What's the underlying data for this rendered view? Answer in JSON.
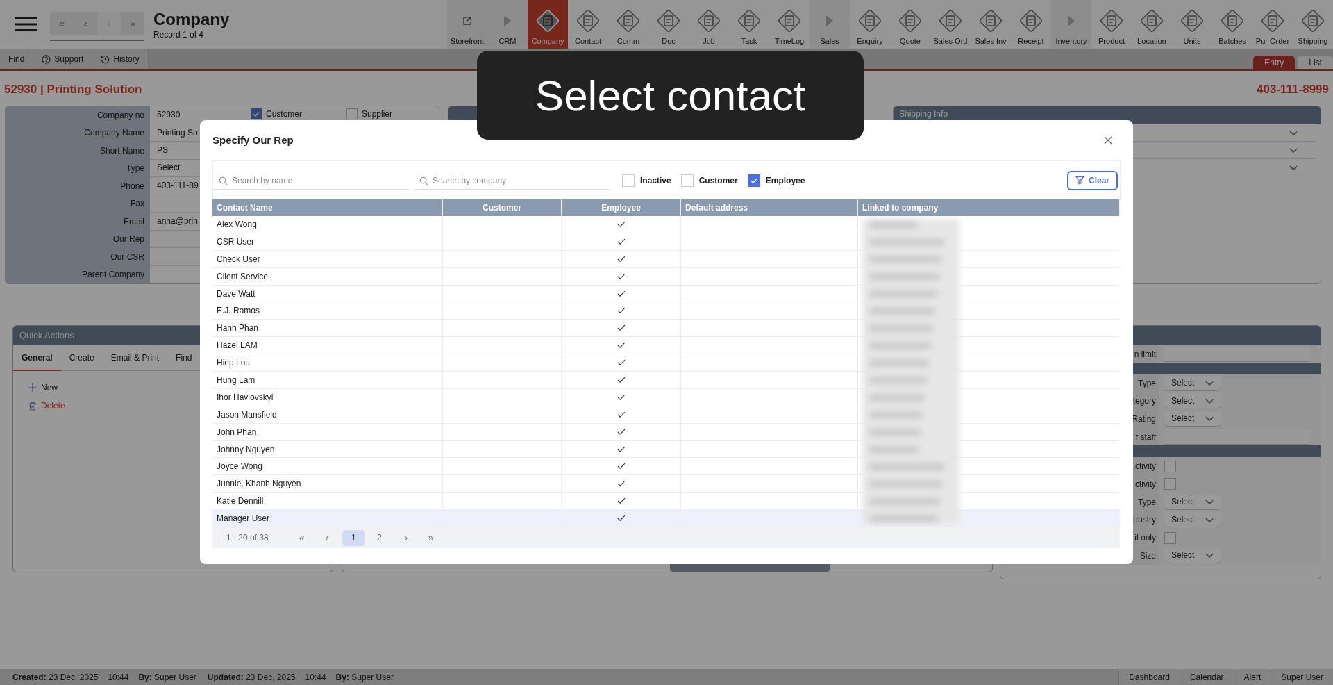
{
  "header": {
    "nav_buttons": [
      {
        "label": "«",
        "disabled": false
      },
      {
        "label": "‹",
        "disabled": false
      },
      {
        "label": "›",
        "disabled": true
      },
      {
        "label": "»",
        "disabled": false
      }
    ],
    "title": "Company",
    "record": "Record 1 of 4"
  },
  "modules": [
    {
      "label": "Storefront",
      "kind": "link",
      "selected": false
    },
    {
      "label": "CRM",
      "kind": "section",
      "selected": false
    },
    {
      "label": "Company",
      "kind": "module",
      "selected": true
    },
    {
      "label": "Contact",
      "kind": "module",
      "selected": false
    },
    {
      "label": "Comm",
      "kind": "module",
      "selected": false
    },
    {
      "label": "Doc",
      "kind": "module",
      "selected": false
    },
    {
      "label": "Job",
      "kind": "module",
      "selected": false
    },
    {
      "label": "Task",
      "kind": "module",
      "selected": false
    },
    {
      "label": "TimeLog",
      "kind": "module",
      "selected": false
    },
    {
      "label": "Sales",
      "kind": "section",
      "selected": false
    },
    {
      "label": "Enquiry",
      "kind": "module",
      "selected": false
    },
    {
      "label": "Quote",
      "kind": "module",
      "selected": false
    },
    {
      "label": "Sales Ord",
      "kind": "module",
      "selected": false
    },
    {
      "label": "Sales Inv",
      "kind": "module",
      "selected": false
    },
    {
      "label": "Receipt",
      "kind": "module",
      "selected": false
    },
    {
      "label": "Inventory",
      "kind": "section",
      "selected": false
    },
    {
      "label": "Product",
      "kind": "module",
      "selected": false
    },
    {
      "label": "Location",
      "kind": "module",
      "selected": false
    },
    {
      "label": "Units",
      "kind": "module",
      "selected": false
    },
    {
      "label": "Batches",
      "kind": "module",
      "selected": false
    },
    {
      "label": "Pur Order",
      "kind": "module",
      "selected": false
    },
    {
      "label": "Shipping",
      "kind": "module",
      "selected": false
    }
  ],
  "toolbar": [
    "Find",
    "Support",
    "History"
  ],
  "view_tabs": [
    {
      "label": "Entry",
      "selected": true
    },
    {
      "label": "List",
      "selected": false
    }
  ],
  "record_title": "52930 | Printing Solution",
  "record_phone": "403-111-8999",
  "company_form": {
    "flags": [
      {
        "label": "Customer",
        "checked": true
      },
      {
        "label": "Supplier",
        "checked": false
      }
    ],
    "rows": [
      {
        "label": "Company no",
        "value": "52930",
        "kind": "text"
      },
      {
        "label": "Company Name",
        "value": "Printing So",
        "kind": "text"
      },
      {
        "label": "Short Name",
        "value": "PS",
        "kind": "text"
      },
      {
        "label": "Type",
        "value": "Select",
        "kind": "select"
      },
      {
        "label": "Phone",
        "value": "403-111-89",
        "kind": "text"
      },
      {
        "label": "Fax",
        "kind": "text"
      },
      {
        "label": "Email",
        "value": "anna@prin",
        "kind": "text"
      },
      {
        "label": "Our Rep",
        "kind": "text"
      },
      {
        "label": "Our CSR",
        "kind": "text"
      },
      {
        "label": "Parent Company",
        "kind": "text"
      }
    ]
  },
  "shipping_panel": {
    "title": "Shipping Info"
  },
  "quick_actions": {
    "title": "Quick Actions",
    "tabs": [
      {
        "label": "General",
        "selected": true
      },
      {
        "label": "Create",
        "selected": false
      },
      {
        "label": "Email & Print",
        "selected": false
      },
      {
        "label": "Find",
        "selected": false
      }
    ],
    "actions": [
      {
        "label": "New",
        "kind": "add"
      },
      {
        "label": "Delete",
        "kind": "delete"
      }
    ]
  },
  "details_panel": {
    "sections": [
      {
        "rows": [
          {
            "label": "n limit",
            "kind": "text"
          }
        ]
      },
      {
        "rows": [
          {
            "label": "Type",
            "kind": "select",
            "value": "Select"
          },
          {
            "label": "tegory",
            "kind": "select",
            "value": "Select"
          },
          {
            "label": "Rating",
            "kind": "select",
            "value": "Select"
          },
          {
            "label": "f staff",
            "kind": "text"
          }
        ]
      },
      {
        "rows": [
          {
            "label": "ctivity",
            "kind": "checkbox",
            "checked": false
          },
          {
            "label": "ctivity",
            "kind": "checkbox",
            "checked": false
          },
          {
            "label": "Type",
            "kind": "select",
            "value": "Select"
          },
          {
            "label": "dustry",
            "kind": "select",
            "value": "Select"
          },
          {
            "label": "il only",
            "kind": "checkbox",
            "checked": false
          },
          {
            "label": "Size",
            "kind": "select",
            "value": "Select"
          }
        ]
      }
    ]
  },
  "footer": {
    "meta": [
      "**Created:** 23 Dec, 2025",
      "10:44",
      "**By:** Super User",
      "**Updated:** 23 Dec, 2025",
      "10:44",
      "**By:** Super User"
    ],
    "buttons": [
      "Dashboard",
      "Calendar",
      "Alert",
      "Super User"
    ]
  },
  "hint": "Select contact",
  "modal": {
    "title": "Specify Our Rep",
    "search_fields": [
      {
        "placeholder": "Search by name"
      },
      {
        "placeholder": "Search by company"
      }
    ],
    "filters": [
      {
        "label": "Inactive",
        "checked": false
      },
      {
        "label": "Customer",
        "checked": false
      },
      {
        "label": "Employee",
        "checked": true
      }
    ],
    "clear_button": "Clear",
    "table": {
      "columns": [
        "Contact Name",
        "Customer",
        "Employee",
        "Default address",
        "Linked to company"
      ],
      "rows": [
        {
          "name": "Alex Wong",
          "employee": true,
          "selected": false
        },
        {
          "name": "CSR User",
          "employee": true,
          "selected": false
        },
        {
          "name": "Check User",
          "employee": true,
          "selected": false
        },
        {
          "name": "Client Service",
          "employee": true,
          "selected": false
        },
        {
          "name": "Dave Watt",
          "employee": true,
          "selected": false
        },
        {
          "name": "E.J. Ramos",
          "employee": true,
          "selected": false
        },
        {
          "name": "Hanh Phan",
          "employee": true,
          "selected": false
        },
        {
          "name": "Hazel LAM",
          "employee": true,
          "selected": false
        },
        {
          "name": "Hiep Luu",
          "employee": true,
          "selected": false
        },
        {
          "name": "Hung Lam",
          "employee": true,
          "selected": false
        },
        {
          "name": "Ihor Havlovskyi",
          "employee": true,
          "selected": false
        },
        {
          "name": "Jason Mansfield",
          "employee": true,
          "selected": false
        },
        {
          "name": "John Phan",
          "employee": true,
          "selected": false
        },
        {
          "name": "Johnny Nguyen",
          "employee": true,
          "selected": false
        },
        {
          "name": "Joyce Wong",
          "employee": true,
          "selected": false
        },
        {
          "name": "Junnie, Khanh Nguyen",
          "employee": true,
          "selected": false
        },
        {
          "name": "Katie Dennill",
          "employee": true,
          "selected": false
        },
        {
          "name": "Manager User",
          "employee": true,
          "selected": true
        }
      ]
    },
    "pagination": {
      "summary": "1 - 20 of 38",
      "first": "«",
      "prev": "‹",
      "pages": [
        {
          "label": "1",
          "selected": true
        },
        {
          "label": "2",
          "selected": false
        }
      ],
      "next": "›",
      "last": "»"
    }
  }
}
